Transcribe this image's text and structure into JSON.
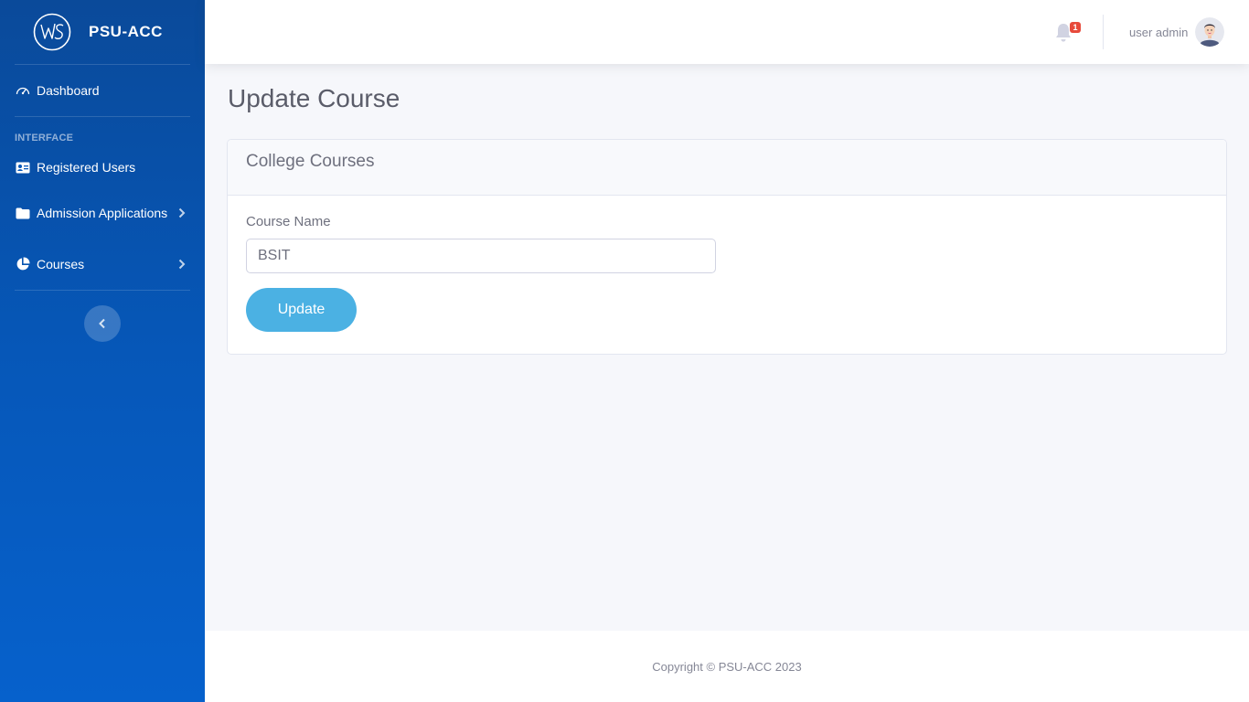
{
  "sidebar": {
    "brand": "PSU-ACC",
    "logo_text": "WS",
    "dashboard": "Dashboard",
    "section_heading": "INTERFACE",
    "items": [
      {
        "label": "Registered Users",
        "icon": "id-card-icon"
      },
      {
        "label": "Admission Applications",
        "icon": "folder-icon"
      },
      {
        "label": "Courses",
        "icon": "pie-chart-icon"
      }
    ]
  },
  "topbar": {
    "notification_count": "1",
    "user_name": "user admin"
  },
  "main": {
    "page_title": "Update Course",
    "card_title": "College Courses",
    "field_label": "Course Name",
    "field_value": "BSIT",
    "submit_label": "Update"
  },
  "footer": {
    "copyright": "Copyright © PSU-ACC 2023"
  },
  "colors": {
    "sidebar_top": "#0a4a9a",
    "sidebar_bottom": "#0661cc",
    "button": "#4bb1e3",
    "badge": "#e74a3b"
  }
}
